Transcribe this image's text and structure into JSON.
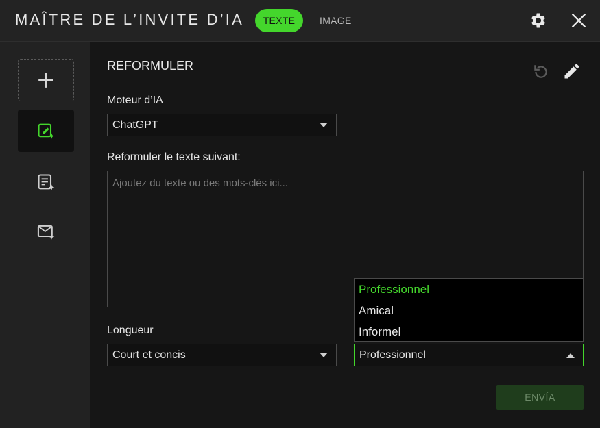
{
  "window": {
    "title": "MAÎTRE DE L’INVITE D’IA",
    "tabs": [
      {
        "label": "TEXTE",
        "active": true
      },
      {
        "label": "IMAGE",
        "active": false
      }
    ],
    "icons": [
      "gear-icon",
      "close-icon"
    ]
  },
  "sidebar": {
    "items": [
      {
        "name": "add",
        "icon": "plus-icon"
      },
      {
        "name": "rephrase",
        "icon": "edit-sparkle-icon",
        "active": true
      },
      {
        "name": "summary",
        "icon": "document-sparkle-icon"
      },
      {
        "name": "email",
        "icon": "mail-sparkle-icon"
      }
    ]
  },
  "main": {
    "section_title": "REFORMULER",
    "engine": {
      "label": "Moteur d’IA",
      "value": "ChatGPT"
    },
    "prompt": {
      "label": "Reformuler le texte suivant:",
      "placeholder": "Ajoutez du texte ou des mots-clés ici..."
    },
    "length": {
      "label": "Longueur",
      "value": "Court et concis"
    },
    "tone": {
      "value": "Professionnel",
      "options": [
        "Professionnel",
        "Amical",
        "Informel"
      ],
      "selected_index": 0
    },
    "send_label": "ENVÍA"
  },
  "colors": {
    "accent": "#44d62c",
    "background": "#161616",
    "sidebar": "#222222"
  }
}
